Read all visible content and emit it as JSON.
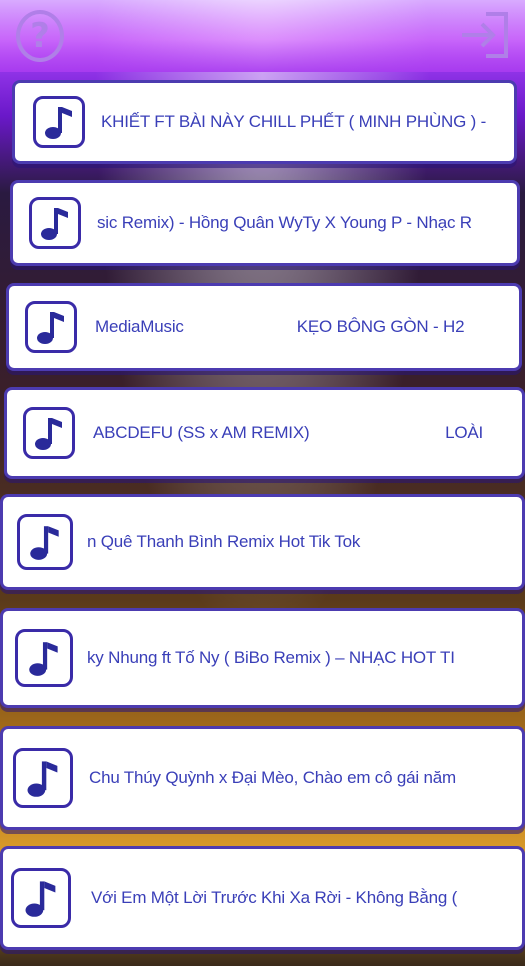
{
  "header": {
    "help_icon": "help-icon",
    "help_glyph": "?",
    "exit_icon": "exit-icon"
  },
  "songs": [
    {
      "title": "KHIẾT FT BÀI NÀY CHILL PHẾT ( MINH PHÙNG ) -",
      "icon": "music-note-icon"
    },
    {
      "title": "sic Remix) - Hồng Quân WyTy X Young P - Nhạc R",
      "icon": "music-note-icon"
    },
    {
      "title": "MediaMusic                         KẸO BÔNG GÒN - H2",
      "icon": "music-note-icon"
    },
    {
      "title": "ABCDEFU (SS x AM REMIX)                              LOÀI",
      "icon": "music-note-icon"
    },
    {
      "title": "n Quê Thanh Bình Remix Hot Tik Tok",
      "icon": "music-note-icon"
    },
    {
      "title": "ky Nhung ft Tố Ny ( BiBo Remix ) – NHẠC HOT TI",
      "icon": "music-note-icon"
    },
    {
      "title": "Chu Thúy Quỳnh x Đại Mèo, Chào em cô gái năm",
      "icon": "music-note-icon"
    },
    {
      "title": "Với Em Một Lời Trước Khi Xa Rời - Không Bằng (",
      "icon": "music-note-icon"
    }
  ],
  "colors": {
    "accent": "#3a2ba8",
    "text": "#3a3fb8",
    "header_top": "#e27aff",
    "card_bg": "#ffffff"
  }
}
